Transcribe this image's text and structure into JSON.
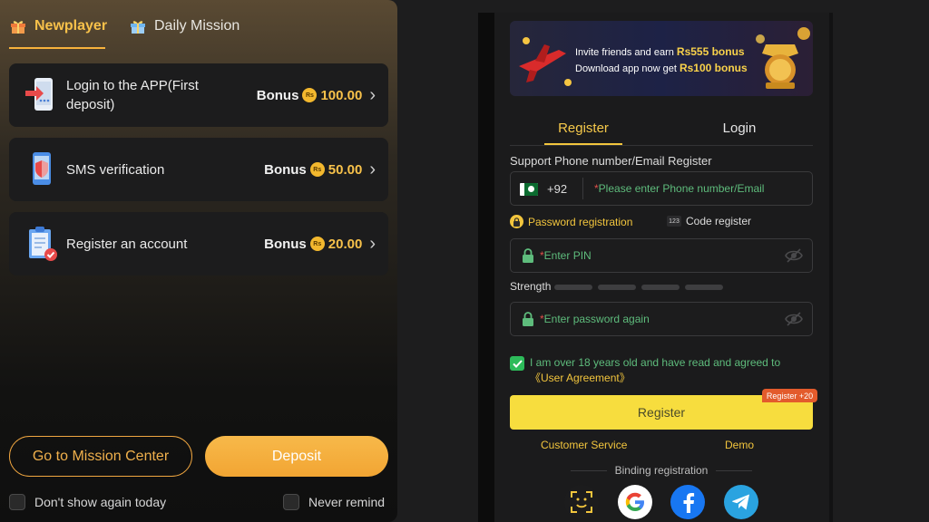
{
  "mission_panel": {
    "tabs": [
      {
        "label": "Newplayer",
        "active": true
      },
      {
        "label": "Daily Mission",
        "active": false
      }
    ],
    "tasks": [
      {
        "label": "Login to the APP(First deposit)",
        "bonus_word": "Bonus",
        "currency": "Rs",
        "amount": "100.00"
      },
      {
        "label": "SMS verification",
        "bonus_word": "Bonus",
        "currency": "Rs",
        "amount": "50.00"
      },
      {
        "label": "Register an account",
        "bonus_word": "Bonus",
        "currency": "Rs",
        "amount": "20.00"
      }
    ],
    "mission_center_label": "Go to Mission Center",
    "deposit_label": "Deposit",
    "dont_show_label": "Don't show again today",
    "never_remind_label": "Never remind"
  },
  "register_panel": {
    "banner": {
      "line1_prefix": "Invite friends and earn ",
      "line1_highlight": "Rs555 bonus",
      "line2_prefix": "Download app now get ",
      "line2_highlight": "Rs100 bonus"
    },
    "tabs": {
      "register": "Register",
      "login": "Login"
    },
    "support_label": "Support Phone number/Email Register",
    "country_code": "+92",
    "phone_placeholder": "Please enter Phone number/Email",
    "password_mode_label": "Password registration",
    "code_mode_label": "Code register",
    "code_mode_icon_text": "123",
    "pin_placeholder": "Enter PIN",
    "strength_label": "Strength",
    "pin_again_placeholder": "Enter password again",
    "agree_text": "I am over 18 years old and have read and agreed to ",
    "agree_link": "《User Agreement》",
    "register_button": "Register",
    "register_badge": "Register +20",
    "customer_service": "Customer Service",
    "demo": "Demo",
    "binding_label": "Binding registration",
    "social_icons": [
      "face-id-icon",
      "google-icon",
      "facebook-icon",
      "telegram-icon"
    ]
  },
  "colors": {
    "accent_gold": "#f7c14a",
    "register_yellow": "#f7dd3e",
    "deposit_orange": "#f2a533",
    "check_green": "#2dbb5a",
    "placeholder_green": "#5ebc7c",
    "badge_red": "#e35b2c"
  }
}
